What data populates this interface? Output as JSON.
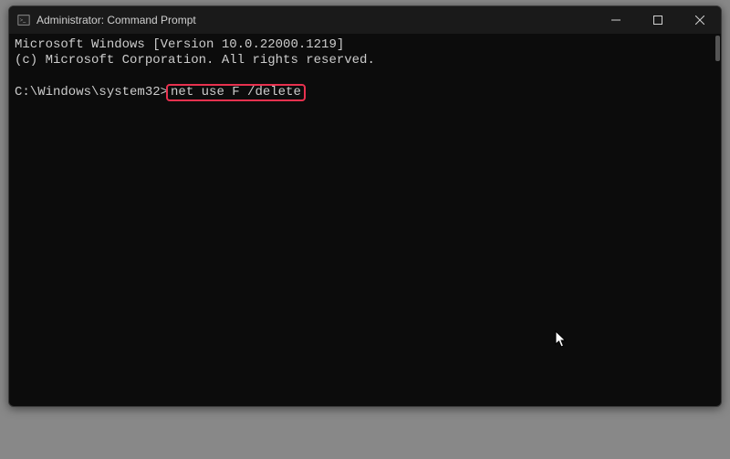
{
  "window": {
    "title": "Administrator: Command Prompt"
  },
  "terminal": {
    "line1": "Microsoft Windows [Version 10.0.22000.1219]",
    "line2": "(c) Microsoft Corporation. All rights reserved.",
    "prompt": "C:\\Windows\\system32>",
    "command": "net use F /delete"
  },
  "icons": {
    "app": "cmd-icon",
    "minimize": "minimize-icon",
    "maximize": "maximize-icon",
    "close": "close-icon"
  },
  "highlight_color": "#e8314f"
}
